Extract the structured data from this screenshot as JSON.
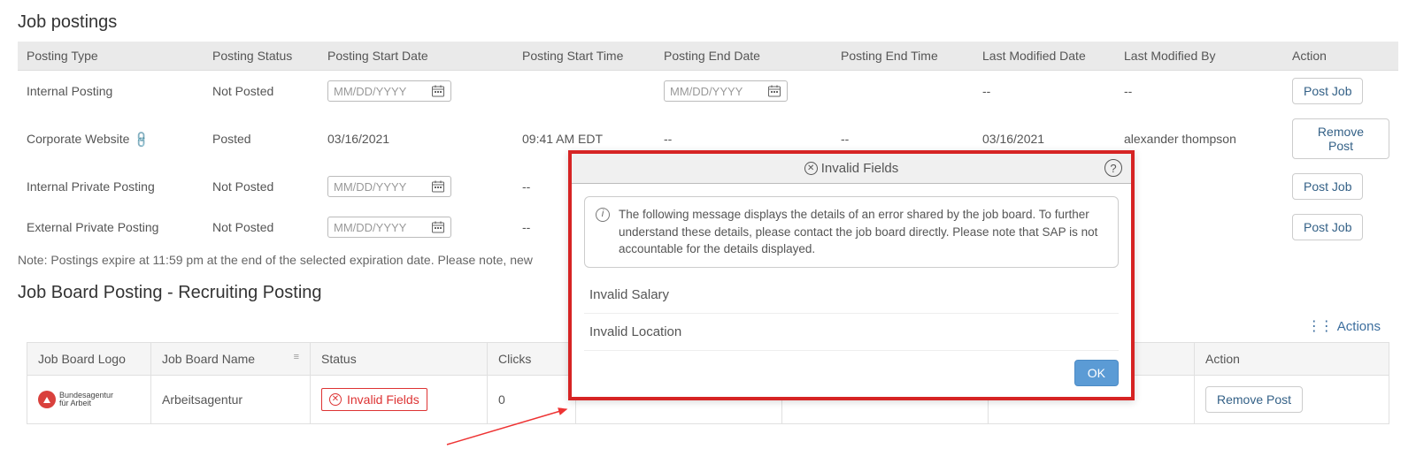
{
  "sections": {
    "postings_title": "Job postings",
    "board_title": "Job Board Posting - Recruiting Posting"
  },
  "postings_table": {
    "headers": [
      "Posting Type",
      "Posting Status",
      "Posting Start Date",
      "Posting Start Time",
      "Posting End Date",
      "Posting End Time",
      "Last Modified Date",
      "Last Modified By",
      "Action"
    ],
    "rows": [
      {
        "type": "Internal Posting",
        "status": "Not Posted",
        "start_date": "MM/DD/YYYY",
        "start_date_is_input": true,
        "start_time": "",
        "end_date": "MM/DD/YYYY",
        "end_date_is_input": true,
        "end_time": "",
        "last_mod_date": "--",
        "last_mod_by": "--",
        "action": "Post Job",
        "has_link": false
      },
      {
        "type": "Corporate Website",
        "status": "Posted",
        "start_date": "03/16/2021",
        "start_date_is_input": false,
        "start_time": "09:41 AM EDT",
        "end_date": "--",
        "end_date_is_input": false,
        "end_time": "--",
        "last_mod_date": "03/16/2021",
        "last_mod_by": "alexander thompson",
        "action": "Remove Post",
        "has_link": true
      },
      {
        "type": "Internal Private Posting",
        "status": "Not Posted",
        "start_date": "MM/DD/YYYY",
        "start_date_is_input": true,
        "start_time": "--",
        "end_date": "",
        "end_date_is_input": false,
        "end_time": "",
        "last_mod_date": "",
        "last_mod_by": "",
        "action": "Post Job",
        "has_link": false
      },
      {
        "type": "External Private Posting",
        "status": "Not Posted",
        "start_date": "MM/DD/YYYY",
        "start_date_is_input": true,
        "start_time": "--",
        "end_date": "",
        "end_date_is_input": false,
        "end_time": "",
        "last_mod_date": "",
        "last_mod_by": "",
        "action": "Post Job",
        "has_link": false
      }
    ]
  },
  "note": "Note: Postings expire at 11:59 pm at the end of the selected expiration date. Please note, new",
  "actions_label": "Actions",
  "boards_table": {
    "headers": [
      "Job Board Logo",
      "Job Board Name",
      "Status",
      "Clicks",
      "",
      "",
      "",
      "Action"
    ],
    "row": {
      "logo_text": "Bundesagentur für Arbeit",
      "name": "Arbeitsagentur",
      "status": "Invalid Fields",
      "clicks": "0",
      "action": "Remove Post"
    }
  },
  "dialog": {
    "title": "Invalid Fields",
    "info": "The following message displays the details of an error shared by the job board. To further understand these details, please contact the job board directly. Please note that SAP is not accountable for the details displayed.",
    "items": [
      "Invalid Salary",
      "Invalid Location"
    ],
    "ok": "OK"
  }
}
